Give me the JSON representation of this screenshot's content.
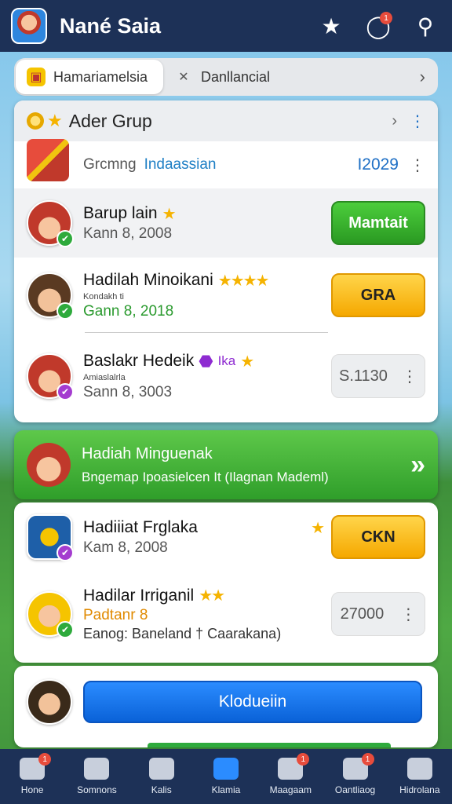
{
  "header": {
    "title": "Nané Saia",
    "badge_count": "1"
  },
  "tabs": [
    {
      "label": "Hamariamelsia",
      "active": true
    },
    {
      "label": "Danllancial",
      "active": false
    }
  ],
  "group_card": {
    "title": "Ader Grup",
    "promo": {
      "label": "Grcmng",
      "link": "Indaassian",
      "value": "I2029"
    },
    "rows": [
      {
        "title": "Barup lain",
        "date": "Kann 8, 2008",
        "button": "Mamtait",
        "button_style": "green"
      },
      {
        "title": "Hadilah Minoikani",
        "subtitle": "Kondakh ti",
        "date": "Gann 8, 2018",
        "button": "GRA",
        "button_style": "yellow",
        "stars": "★★★★"
      },
      {
        "title": "Baslakr Hedeik",
        "tag": "Ika",
        "subtitle": "Amiaslalrla",
        "date": "Sann 8, 3003",
        "value": "S.1130"
      }
    ]
  },
  "banner": {
    "title": "Hadiah Minguenak",
    "subtitle": "Bngemap Ipoasielcen It (Ilagnan Mademl)"
  },
  "list_card": {
    "rows": [
      {
        "title": "Hadiiiat Frglaka",
        "date": "Kam 8, 2008",
        "button": "CKN",
        "button_style": "yellow"
      },
      {
        "title": "Hadilar Irriganil",
        "subtitle": "Padtanr 8",
        "date": "Eanog: Baneland † Caarakana)",
        "value": "27000",
        "stars": "★★"
      }
    ]
  },
  "action_card": {
    "button": "Klodueiin"
  },
  "bottom_nav": [
    {
      "label": "Hone",
      "badge": "1",
      "active": false
    },
    {
      "label": "Somnons",
      "badge": "",
      "active": false
    },
    {
      "label": "Kalis",
      "badge": "",
      "active": false
    },
    {
      "label": "Klamia",
      "badge": "",
      "active": true
    },
    {
      "label": "Maagaam",
      "badge": "1",
      "active": false
    },
    {
      "label": "Oantliaog",
      "badge": "1",
      "active": false
    },
    {
      "label": "Hidrolana",
      "badge": "",
      "active": false
    }
  ]
}
